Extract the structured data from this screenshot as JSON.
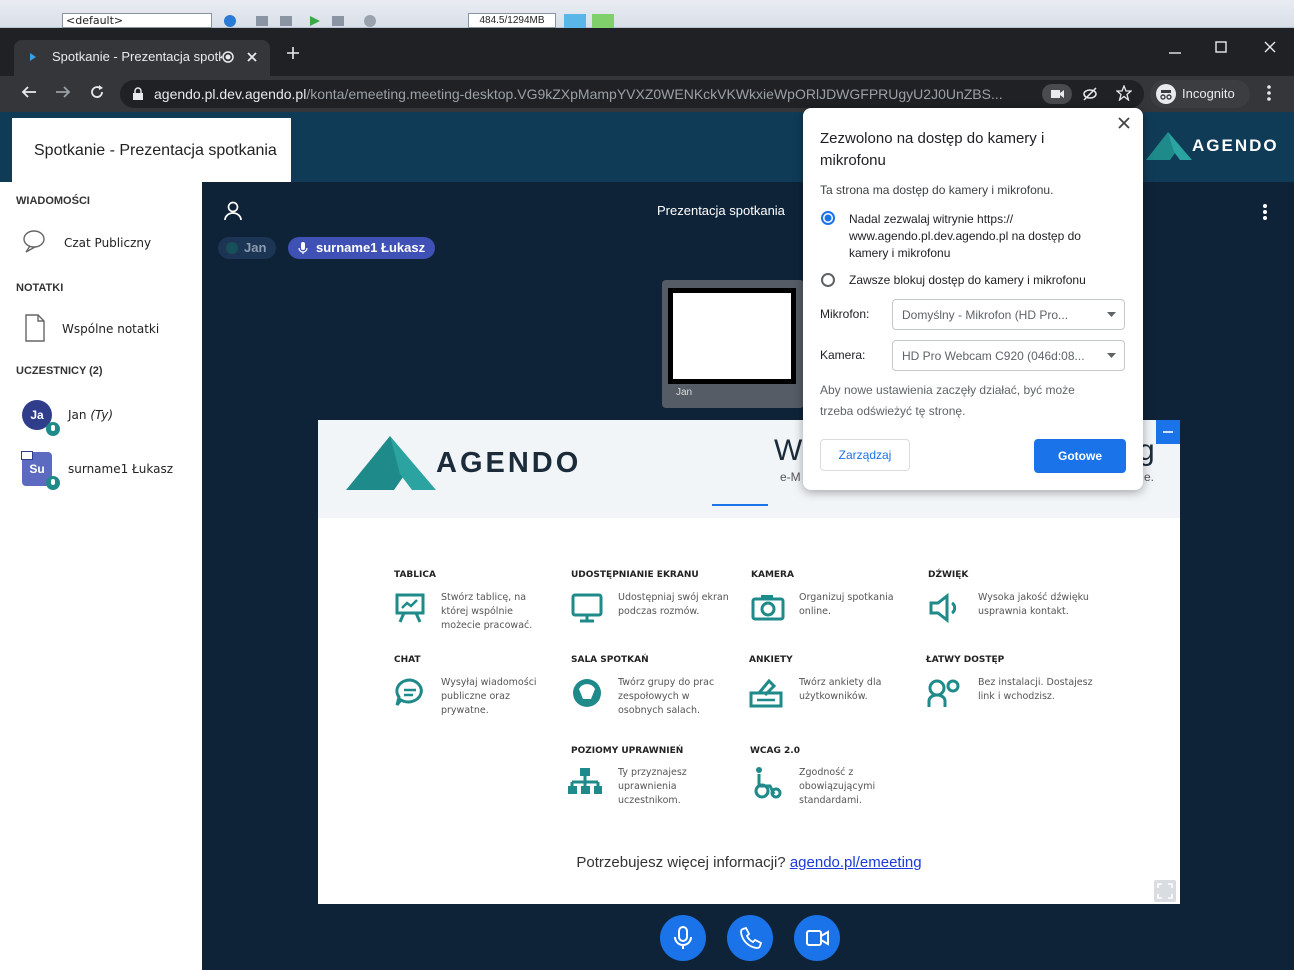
{
  "os": {
    "combo_value": "<default>",
    "memory": "484.5/1294MB"
  },
  "browser": {
    "tab_title": "Spotkanie - Prezentacja spotkania",
    "url_host": "agendo.pl.dev.agendo.pl",
    "url_path": "/konta/emeeting.meeting-desktop.VG9kZXpMampYVXZ0WENKckVKWkxieWpORlJDWGFPRUgyU2J0UnZBS...",
    "incognito_label": "Incognito"
  },
  "app": {
    "page_title": "Spotkanie - Prezentacja spotkania",
    "logo_text": "AGENDO"
  },
  "sidebar": {
    "messages_header": "WIADOMOŚCI",
    "public_chat": "Czat Publiczny",
    "notes_header": "NOTATKI",
    "shared_notes": "Wspólne notatki",
    "participants_header": "UCZESTNICY (2)",
    "participants": [
      {
        "initials": "Ja",
        "name": "Jan",
        "suffix": "(Ty)",
        "color": "#2f3d8a"
      },
      {
        "initials": "Su",
        "name": "surname1 Łukasz",
        "suffix": "",
        "color": "#5c6bc0"
      }
    ]
  },
  "meeting": {
    "title": "Prezentacja spotkania",
    "pill_jan": "Jan",
    "pill_speaker": "surname1 Łukasz",
    "video_label": "Jan"
  },
  "slide": {
    "logo_text": "AGENDO",
    "heading_fragment_left": "Wi",
    "heading_fragment_right": "g",
    "sub_fragment_left": "e-M",
    "sub_fragment_right": "e.",
    "features": [
      {
        "title": "TABLICA",
        "desc": "Stwórz tablicę, na której wspólnie możecie pracować."
      },
      {
        "title": "UDOSTĘPNIANIE EKRANU",
        "desc": "Udostępniaj swój ekran podczas rozmów."
      },
      {
        "title": "KAMERA",
        "desc": "Organizuj spotkania online."
      },
      {
        "title": "DŹWIĘK",
        "desc": "Wysoka jakość dźwięku usprawnia kontakt."
      },
      {
        "title": "CHAT",
        "desc": "Wysyłaj wiadomości publiczne oraz prywatne."
      },
      {
        "title": "SALA SPOTKAŃ",
        "desc": "Twórz grupy do prac zespołowych w osobnych salach."
      },
      {
        "title": "ANKIETY",
        "desc": "Twórz ankiety dla użytkowników."
      },
      {
        "title": "ŁATWY DOSTĘP",
        "desc": "Bez instalacji. Dostajesz link i wchodzisz."
      },
      {
        "title": "POZIOMY UPRAWNIEŃ",
        "desc": "Ty przyznajesz uprawnienia uczestnikom."
      },
      {
        "title": "WCAG 2.0",
        "desc": "Zgodność z obowiązującymi standardami."
      }
    ],
    "footer_text": "Potrzebujesz więcej informacji?",
    "footer_link": "agendo.pl/emeeting"
  },
  "popup": {
    "title": "Zezwolono na dostęp do kamery i mikrofonu",
    "subtitle": "Ta strona ma dostęp do kamery i mikrofonu.",
    "option_allow": "Nadal zezwalaj witrynie https:// www.agendo.pl.dev.agendo.pl na dostęp do kamery i mikrofonu",
    "option_block": "Zawsze blokuj dostęp do kamery i mikrofonu",
    "mic_label": "Mikrofon:",
    "mic_value": "Domyślny - Mikrofon (HD Pro...",
    "cam_label": "Kamera:",
    "cam_value": "HD Pro Webcam C920 (046d:08...",
    "note": "Aby nowe ustawienia zaczęły działać, być może trzeba odświeżyć tę stronę.",
    "manage_button": "Zarządzaj",
    "done_button": "Gotowe"
  },
  "colors": {
    "accent": "#1a73e8",
    "app_header": "#103b57",
    "main_bg": "#0f2338",
    "logo_teal": "#1f8a8a"
  }
}
